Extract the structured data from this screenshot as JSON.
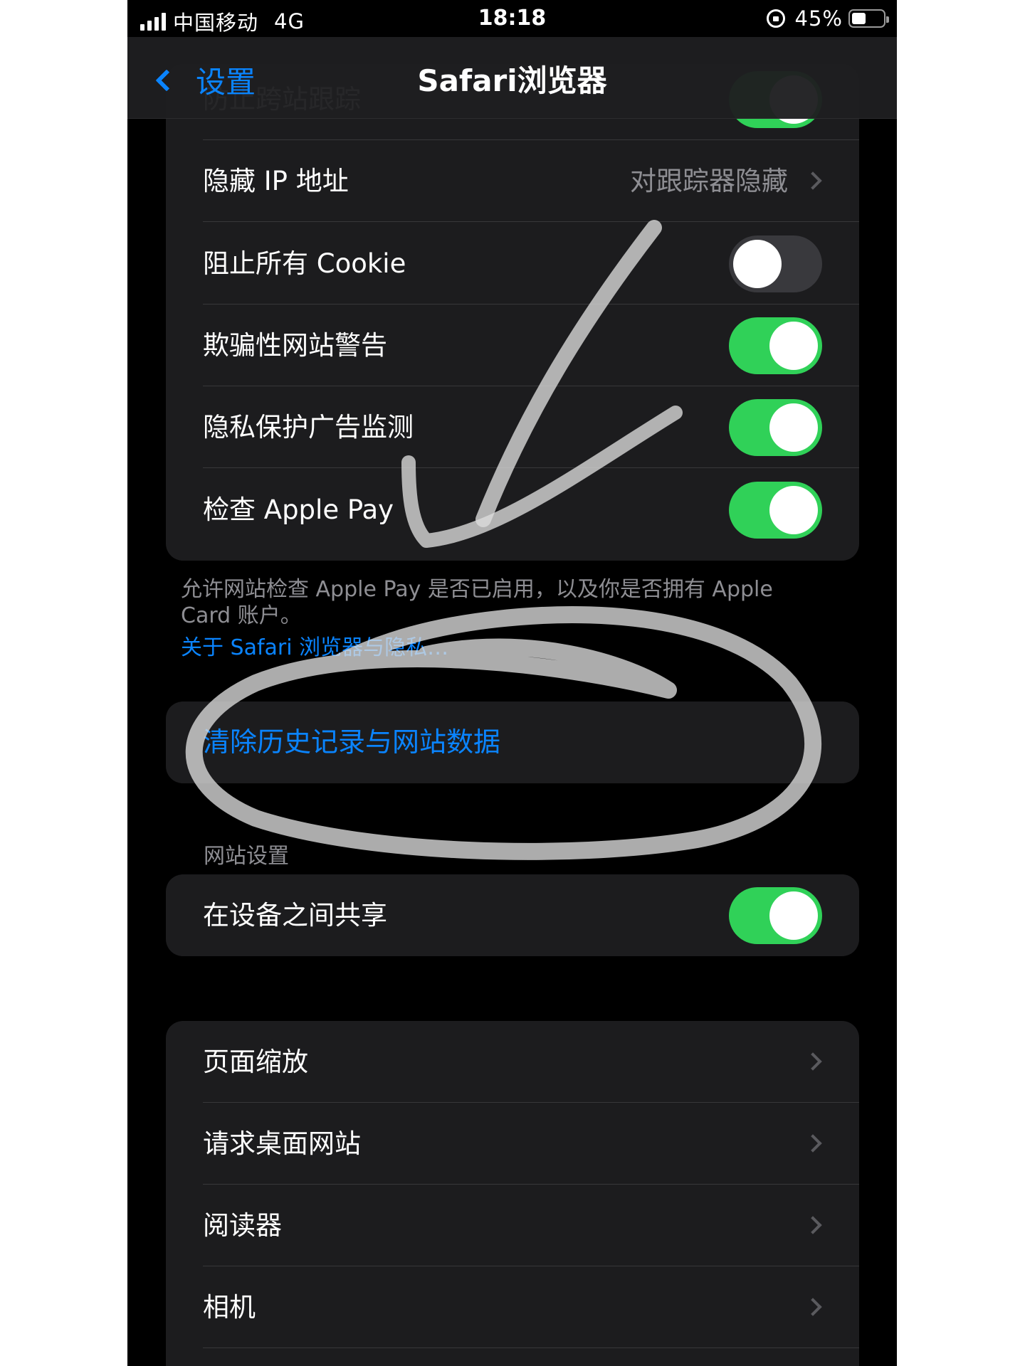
{
  "status_bar": {
    "carrier": "中国移动",
    "network": "4G",
    "time": "18:18",
    "battery_percent": "45%",
    "battery_level": 0.45,
    "signal_icon": "signal-bars-icon",
    "rotation_lock_icon": "rotation-lock-icon"
  },
  "nav": {
    "back_label": "设置",
    "title": "Safari浏览器"
  },
  "privacy_group": {
    "partial_top_label": "防止跨站跟踪",
    "hide_ip": {
      "label": "隐藏 IP 地址",
      "value": "对跟踪器隐藏"
    },
    "block_cookies": {
      "label": "阻止所有 Cookie",
      "on": false
    },
    "fraud_warning": {
      "label": "欺骗性网站警告",
      "on": true
    },
    "ad_measurement": {
      "label": "隐私保护广告监测",
      "on": true
    },
    "apple_pay": {
      "label": "检查 Apple Pay",
      "on": true
    }
  },
  "privacy_footer": {
    "text": "允许网站检查 Apple Pay 是否已启用，以及你是否拥有 Apple Card 账户。",
    "link": "关于 Safari 浏览器与隐私…"
  },
  "clear_history": {
    "label": "清除历史记录与网站数据"
  },
  "website_settings": {
    "header": "网站设置",
    "share_across_devices": {
      "label": "在设备之间共享",
      "on": true
    }
  },
  "per_site_group": {
    "items": [
      {
        "label": "页面缩放"
      },
      {
        "label": "请求桌面网站"
      },
      {
        "label": "阅读器"
      },
      {
        "label": "相机"
      }
    ]
  },
  "colors": {
    "accent": "#0a84ff",
    "toggle_on": "#30d158",
    "cell_background": "#1c1c1e",
    "background": "#000000"
  }
}
